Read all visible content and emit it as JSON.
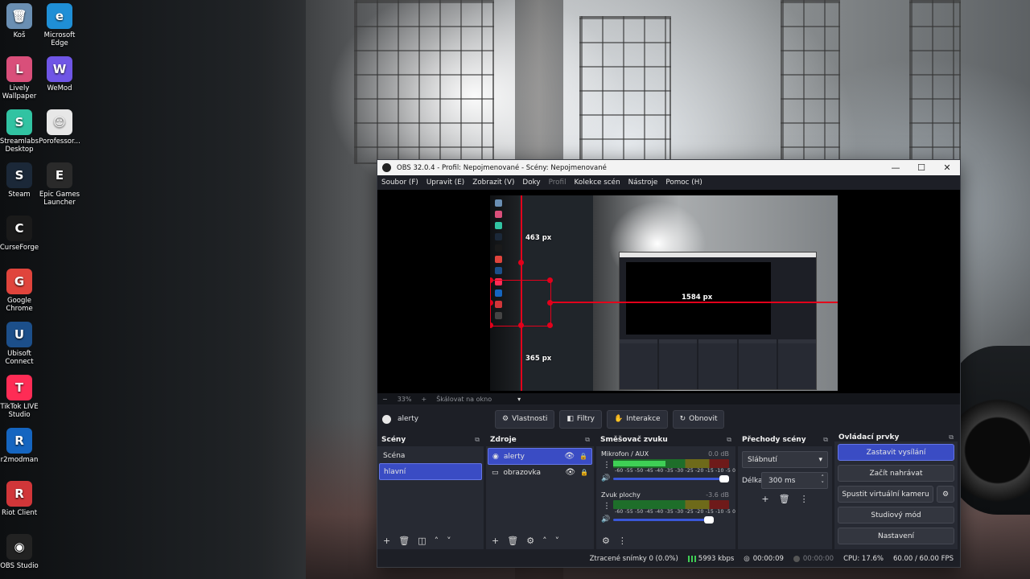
{
  "desktop": {
    "icons": [
      {
        "label": "Koš",
        "color": "#6a8fb3",
        "glyph": "🗑"
      },
      {
        "label": "Microsoft Edge",
        "color": "#1f8fd6",
        "glyph": "e"
      },
      {
        "label": "Lively Wallpaper",
        "color": "#d94f7a",
        "glyph": "L"
      },
      {
        "label": "WeMod",
        "color": "#6f56e6",
        "glyph": "W"
      },
      {
        "label": "Streamlabs Desktop",
        "color": "#31c3a2",
        "glyph": "S"
      },
      {
        "label": "Porofessor...",
        "color": "#e7e7e7",
        "glyph": "☺"
      },
      {
        "label": "Steam",
        "color": "#1b2838",
        "glyph": "S"
      },
      {
        "label": "Epic Games Launcher",
        "color": "#2a2a2a",
        "glyph": "E"
      },
      {
        "label": "CurseForge",
        "color": "#1a1a1a",
        "glyph": "C"
      },
      {
        "label": "Google Chrome",
        "color": "#e0443c",
        "glyph": "G"
      },
      {
        "label": "Ubisoft Connect",
        "color": "#1c4f8a",
        "glyph": "U"
      },
      {
        "label": "TikTok LIVE Studio",
        "color": "#fe2c55",
        "glyph": "T"
      },
      {
        "label": "r2modman",
        "color": "#1565c0",
        "glyph": "R"
      },
      {
        "label": "Riot Client",
        "color": "#d13639",
        "glyph": "R"
      },
      {
        "label": "OBS Studio",
        "color": "#222222",
        "glyph": "◉"
      }
    ]
  },
  "obs": {
    "title": "OBS 32.0.4 - Profil: Nepojmenované - Scény: Nepojmenované",
    "window_buttons": {
      "minimize": "—",
      "maximize": "☐",
      "close": "✕"
    },
    "menu": [
      {
        "label": "Soubor (F)",
        "enabled": true
      },
      {
        "label": "Upravit (E)",
        "enabled": true
      },
      {
        "label": "Zobrazit (V)",
        "enabled": true
      },
      {
        "label": "Doky",
        "enabled": true
      },
      {
        "label": "Profil",
        "enabled": false
      },
      {
        "label": "Kolekce scén",
        "enabled": true
      },
      {
        "label": "Nástroje",
        "enabled": true
      },
      {
        "label": "Pomoc (H)",
        "enabled": true
      }
    ],
    "preview": {
      "distance_top": "463 px",
      "distance_bottom": "365 px",
      "distance_right": "1584 px"
    },
    "zoom": {
      "minus": "−",
      "level": "33%",
      "plus": "+",
      "scale_label": "Škálovat na okno",
      "arrow": "▾"
    },
    "source_toolbar": {
      "current_source": "alerty",
      "buttons": [
        "Vlastnosti",
        "Filtry",
        "Interakce",
        "Obnovit"
      ],
      "icons": [
        "⚙",
        "◧",
        "✋",
        "↻"
      ]
    },
    "scenes": {
      "header": "Scény",
      "items": [
        {
          "label": "Scéna",
          "selected": false
        },
        {
          "label": "hlavní",
          "selected": true
        }
      ]
    },
    "sources": {
      "header": "Zdroje",
      "items": [
        {
          "label": "alerty",
          "selected": true,
          "icon": "◉"
        },
        {
          "label": "obrazovka",
          "selected": false,
          "icon": "▭"
        }
      ]
    },
    "mixer": {
      "header": "Směšovač zvuku",
      "scale": "-60 -55 -50 -45 -40 -35 -30 -25 -20 -15 -10 -5 0",
      "channels": [
        {
          "name": "Mikrofon / AUX",
          "db": "0.0 dB",
          "level": 0.45,
          "volume": 1.0
        },
        {
          "name": "Zvuk plochy",
          "db": "-3.6 dB",
          "level": 0.0,
          "volume": 0.85
        }
      ]
    },
    "transitions": {
      "header": "Přechody scény",
      "selected": "Slábnutí",
      "duration_label": "Délka",
      "duration_value": "300 ms"
    },
    "controls": {
      "header": "Ovládací prvky",
      "buttons": [
        {
          "label": "Zastavit vysílání",
          "active": true
        },
        {
          "label": "Začít nahrávat",
          "active": false
        },
        {
          "label": "Spustit virtuální kameru",
          "active": false
        },
        {
          "label": "Studiový mód",
          "active": false
        },
        {
          "label": "Nastavení",
          "active": false
        }
      ]
    },
    "status": {
      "dropped": "Ztracené snímky 0 (0.0%)",
      "bitrate": "5993 kbps",
      "stream_time": "00:00:09",
      "rec_time": "00:00:00",
      "cpu": "CPU: 17.6%",
      "fps": "60.00 / 60.00 FPS"
    }
  }
}
